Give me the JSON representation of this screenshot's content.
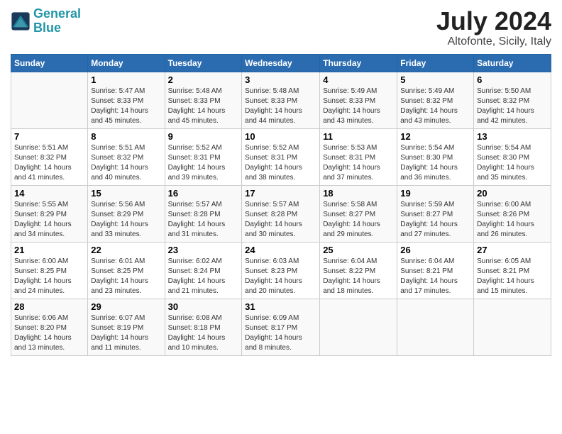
{
  "header": {
    "logo_line1": "General",
    "logo_line2": "Blue",
    "month_year": "July 2024",
    "location": "Altofonte, Sicily, Italy"
  },
  "weekdays": [
    "Sunday",
    "Monday",
    "Tuesday",
    "Wednesday",
    "Thursday",
    "Friday",
    "Saturday"
  ],
  "weeks": [
    [
      {
        "day": "",
        "info": ""
      },
      {
        "day": "1",
        "info": "Sunrise: 5:47 AM\nSunset: 8:33 PM\nDaylight: 14 hours\nand 45 minutes."
      },
      {
        "day": "2",
        "info": "Sunrise: 5:48 AM\nSunset: 8:33 PM\nDaylight: 14 hours\nand 45 minutes."
      },
      {
        "day": "3",
        "info": "Sunrise: 5:48 AM\nSunset: 8:33 PM\nDaylight: 14 hours\nand 44 minutes."
      },
      {
        "day": "4",
        "info": "Sunrise: 5:49 AM\nSunset: 8:33 PM\nDaylight: 14 hours\nand 43 minutes."
      },
      {
        "day": "5",
        "info": "Sunrise: 5:49 AM\nSunset: 8:32 PM\nDaylight: 14 hours\nand 43 minutes."
      },
      {
        "day": "6",
        "info": "Sunrise: 5:50 AM\nSunset: 8:32 PM\nDaylight: 14 hours\nand 42 minutes."
      }
    ],
    [
      {
        "day": "7",
        "info": "Sunrise: 5:51 AM\nSunset: 8:32 PM\nDaylight: 14 hours\nand 41 minutes."
      },
      {
        "day": "8",
        "info": "Sunrise: 5:51 AM\nSunset: 8:32 PM\nDaylight: 14 hours\nand 40 minutes."
      },
      {
        "day": "9",
        "info": "Sunrise: 5:52 AM\nSunset: 8:31 PM\nDaylight: 14 hours\nand 39 minutes."
      },
      {
        "day": "10",
        "info": "Sunrise: 5:52 AM\nSunset: 8:31 PM\nDaylight: 14 hours\nand 38 minutes."
      },
      {
        "day": "11",
        "info": "Sunrise: 5:53 AM\nSunset: 8:31 PM\nDaylight: 14 hours\nand 37 minutes."
      },
      {
        "day": "12",
        "info": "Sunrise: 5:54 AM\nSunset: 8:30 PM\nDaylight: 14 hours\nand 36 minutes."
      },
      {
        "day": "13",
        "info": "Sunrise: 5:54 AM\nSunset: 8:30 PM\nDaylight: 14 hours\nand 35 minutes."
      }
    ],
    [
      {
        "day": "14",
        "info": "Sunrise: 5:55 AM\nSunset: 8:29 PM\nDaylight: 14 hours\nand 34 minutes."
      },
      {
        "day": "15",
        "info": "Sunrise: 5:56 AM\nSunset: 8:29 PM\nDaylight: 14 hours\nand 33 minutes."
      },
      {
        "day": "16",
        "info": "Sunrise: 5:57 AM\nSunset: 8:28 PM\nDaylight: 14 hours\nand 31 minutes."
      },
      {
        "day": "17",
        "info": "Sunrise: 5:57 AM\nSunset: 8:28 PM\nDaylight: 14 hours\nand 30 minutes."
      },
      {
        "day": "18",
        "info": "Sunrise: 5:58 AM\nSunset: 8:27 PM\nDaylight: 14 hours\nand 29 minutes."
      },
      {
        "day": "19",
        "info": "Sunrise: 5:59 AM\nSunset: 8:27 PM\nDaylight: 14 hours\nand 27 minutes."
      },
      {
        "day": "20",
        "info": "Sunrise: 6:00 AM\nSunset: 8:26 PM\nDaylight: 14 hours\nand 26 minutes."
      }
    ],
    [
      {
        "day": "21",
        "info": "Sunrise: 6:00 AM\nSunset: 8:25 PM\nDaylight: 14 hours\nand 24 minutes."
      },
      {
        "day": "22",
        "info": "Sunrise: 6:01 AM\nSunset: 8:25 PM\nDaylight: 14 hours\nand 23 minutes."
      },
      {
        "day": "23",
        "info": "Sunrise: 6:02 AM\nSunset: 8:24 PM\nDaylight: 14 hours\nand 21 minutes."
      },
      {
        "day": "24",
        "info": "Sunrise: 6:03 AM\nSunset: 8:23 PM\nDaylight: 14 hours\nand 20 minutes."
      },
      {
        "day": "25",
        "info": "Sunrise: 6:04 AM\nSunset: 8:22 PM\nDaylight: 14 hours\nand 18 minutes."
      },
      {
        "day": "26",
        "info": "Sunrise: 6:04 AM\nSunset: 8:21 PM\nDaylight: 14 hours\nand 17 minutes."
      },
      {
        "day": "27",
        "info": "Sunrise: 6:05 AM\nSunset: 8:21 PM\nDaylight: 14 hours\nand 15 minutes."
      }
    ],
    [
      {
        "day": "28",
        "info": "Sunrise: 6:06 AM\nSunset: 8:20 PM\nDaylight: 14 hours\nand 13 minutes."
      },
      {
        "day": "29",
        "info": "Sunrise: 6:07 AM\nSunset: 8:19 PM\nDaylight: 14 hours\nand 11 minutes."
      },
      {
        "day": "30",
        "info": "Sunrise: 6:08 AM\nSunset: 8:18 PM\nDaylight: 14 hours\nand 10 minutes."
      },
      {
        "day": "31",
        "info": "Sunrise: 6:09 AM\nSunset: 8:17 PM\nDaylight: 14 hours\nand 8 minutes."
      },
      {
        "day": "",
        "info": ""
      },
      {
        "day": "",
        "info": ""
      },
      {
        "day": "",
        "info": ""
      }
    ]
  ]
}
